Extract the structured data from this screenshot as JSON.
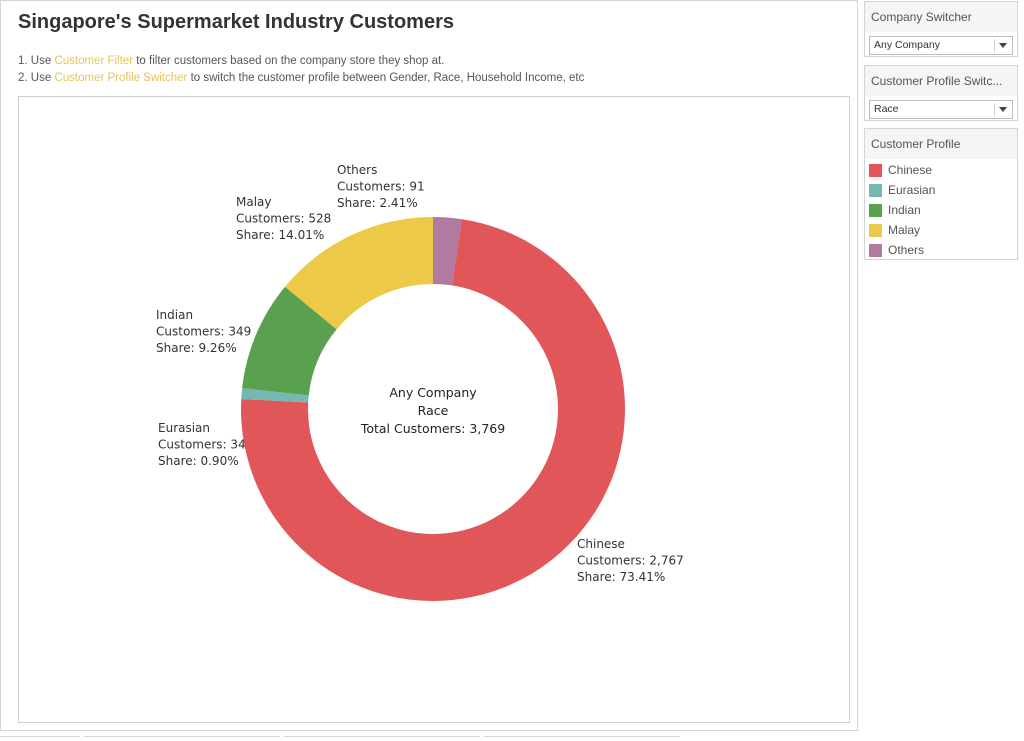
{
  "dashboard": {
    "title": "Singapore's Supermarket Industry Customers",
    "instructions": [
      {
        "prefix": "1. Use ",
        "highlight": "Customer Filter",
        "suffix": " to filter customers based on the company store they shop at."
      },
      {
        "prefix": "2. Use ",
        "highlight": "Customer Profile Switcher",
        "suffix": " to switch the customer profile between Gender, Race, Household Income, etc"
      }
    ],
    "highlight_color": "#e8c35a"
  },
  "company_switcher": {
    "header": "Company Switcher",
    "selected": "Any Company"
  },
  "profile_switcher": {
    "header": "Customer Profile Switc...",
    "selected": "Race"
  },
  "legend": {
    "header": "Customer Profile",
    "items": [
      {
        "label": "Chinese",
        "color": "#e15759"
      },
      {
        "label": "Eurasian",
        "color": "#76b7b2"
      },
      {
        "label": "Indian",
        "color": "#59a14f"
      },
      {
        "label": "Malay",
        "color": "#edc948"
      },
      {
        "label": "Others",
        "color": "#b07aa1"
      }
    ]
  },
  "chart_data": {
    "type": "pie",
    "subtype": "donut",
    "center_text": [
      "Any Company",
      "Race",
      "Total Customers: 3,769"
    ],
    "slices": [
      {
        "name": "Others",
        "customers": 91,
        "share": 2.41,
        "color": "#b07aa1",
        "label_lines": [
          "Others",
          "Customers: 91",
          "Share: 2.41%"
        ]
      },
      {
        "name": "Chinese",
        "customers": 2767,
        "share": 73.41,
        "color": "#e15759",
        "label_lines": [
          "Chinese",
          "Customers: 2,767",
          "Share: 73.41%"
        ]
      },
      {
        "name": "Eurasian",
        "customers": 34,
        "share": 0.9,
        "color": "#76b7b2",
        "label_lines": [
          "Eurasian",
          "Customers: 34",
          "Share: 0.90%"
        ]
      },
      {
        "name": "Indian",
        "customers": 349,
        "share": 9.26,
        "color": "#59a14f",
        "label_lines": [
          "Indian",
          "Customers: 349",
          "Share: 9.26%"
        ]
      },
      {
        "name": "Malay",
        "customers": 528,
        "share": 14.01,
        "color": "#edc948",
        "label_lines": [
          "Malay",
          "Customers: 528",
          "Share: 14.01%"
        ]
      }
    ]
  }
}
